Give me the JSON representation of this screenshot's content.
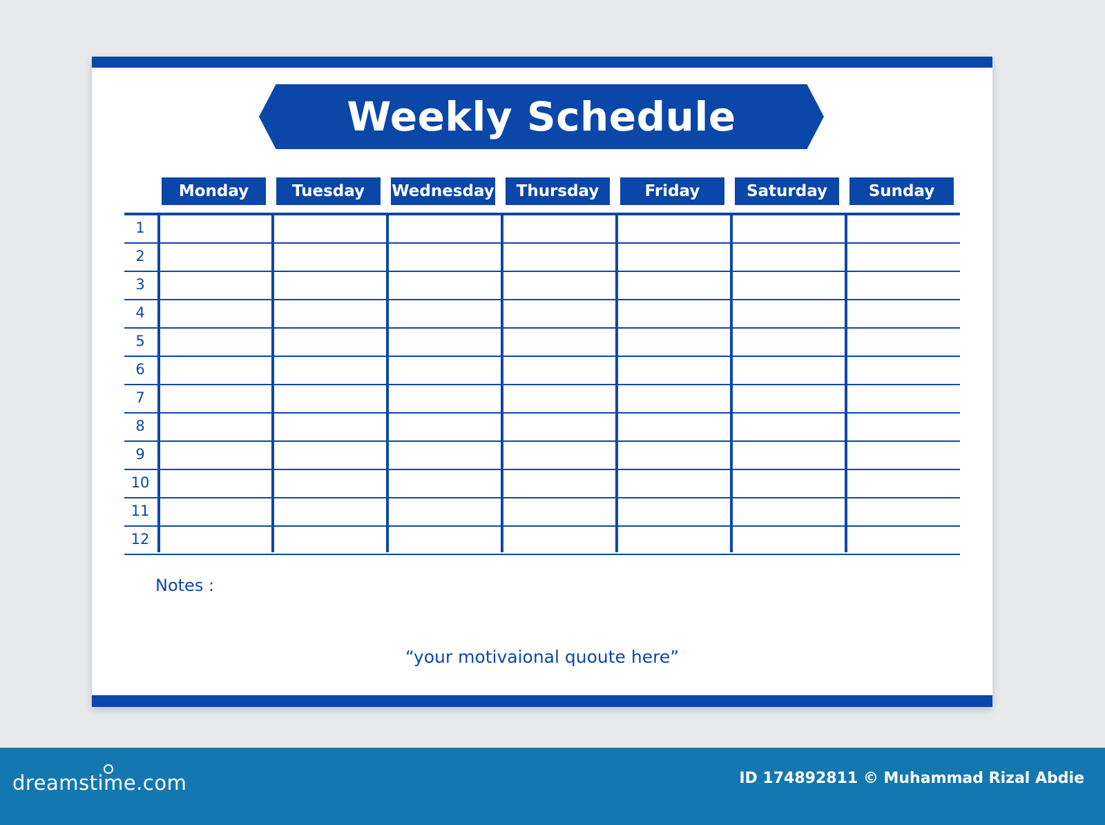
{
  "title": "Weekly Schedule",
  "days": [
    "Monday",
    "Tuesday",
    "Wednesday",
    "Thursday",
    "Friday",
    "Saturday",
    "Sunday"
  ],
  "rows": [
    "1",
    "2",
    "3",
    "4",
    "5",
    "6",
    "7",
    "8",
    "9",
    "10",
    "11",
    "12"
  ],
  "notes_label": "Notes :",
  "quote": "“your motivaional quoute here”",
  "footer": {
    "logo": "dreamstime.com",
    "credit": "ID 174892811 © Muhammad Rizal Abdie"
  },
  "colors": {
    "primary": "#0b47a8",
    "footer": "#1478b0",
    "background": "#e8e9eb"
  }
}
